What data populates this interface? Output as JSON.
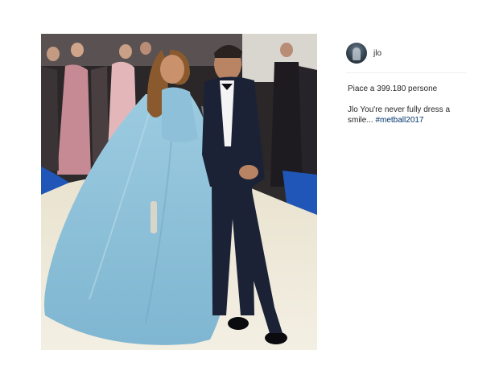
{
  "post": {
    "username": "jlo",
    "likes_text": "Piace a 399.180 persone",
    "caption": {
      "author": "Jlo",
      "text": "You're never fully dress a smile...",
      "hashtag": "#metball2017"
    }
  },
  "icons": {
    "avatar": "profile-avatar"
  },
  "colors": {
    "hashtag": "#003569",
    "text": "#262626",
    "gown": "#8ec1d9",
    "carpet_blue": "#1f56b8"
  }
}
